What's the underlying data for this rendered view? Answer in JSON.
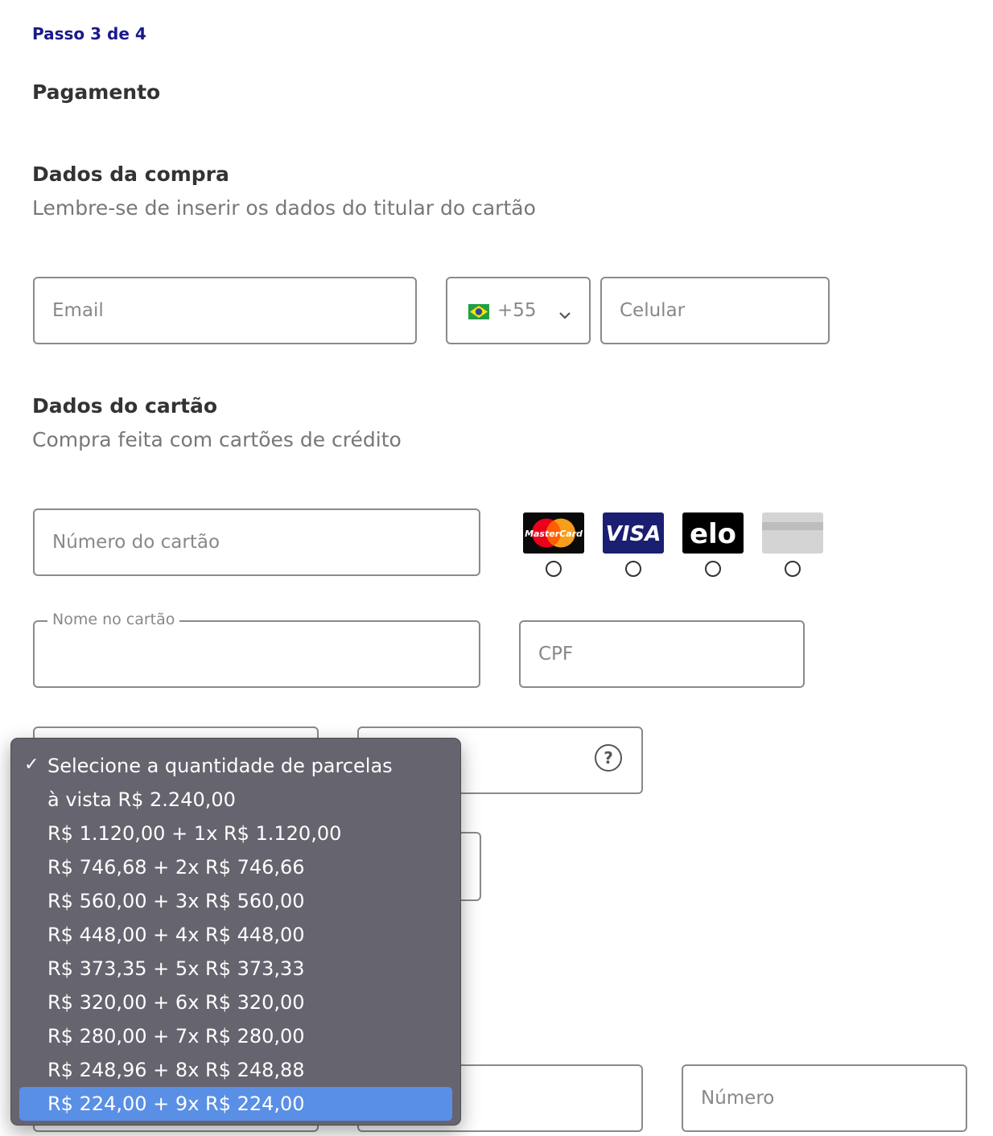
{
  "step_label": "Passo 3 de 4",
  "page_title": "Pagamento",
  "purchase_section": {
    "title": "Dados da compra",
    "subtitle": "Lembre-se de inserir os dados do titular do cartão",
    "email_placeholder": "Email",
    "country_code": "+55",
    "phone_placeholder": "Celular"
  },
  "card_section": {
    "title": "Dados do cartão",
    "subtitle": "Compra feita com cartões de crédito",
    "card_number_placeholder": "Número do cartão",
    "card_brands": [
      "MasterCard",
      "VISA",
      "elo",
      "generic-card"
    ],
    "name_label": "Nome no cartão",
    "cpf_placeholder": "CPF",
    "number_placeholder": "Número"
  },
  "installments_dropdown": {
    "options": [
      "Selecione a quantidade de parcelas",
      "à vista R$ 2.240,00",
      "R$ 1.120,00 + 1x R$ 1.120,00",
      "R$ 746,68 + 2x R$ 746,66",
      "R$ 560,00 + 3x R$ 560,00",
      "R$ 448,00 + 4x R$ 448,00",
      "R$ 373,35 + 5x R$ 373,33",
      "R$ 320,00 + 6x R$ 320,00",
      "R$ 280,00 + 7x R$ 280,00",
      "R$ 248,96 + 8x R$ 248,88",
      "R$ 224,00 + 9x R$ 224,00"
    ],
    "checked_index": 0,
    "highlighted_index": 10,
    "check_mark": "✓"
  },
  "colors": {
    "step_color": "#1a1a8a",
    "dropdown_bg": "#66646e",
    "highlight": "#5a8fe6"
  }
}
